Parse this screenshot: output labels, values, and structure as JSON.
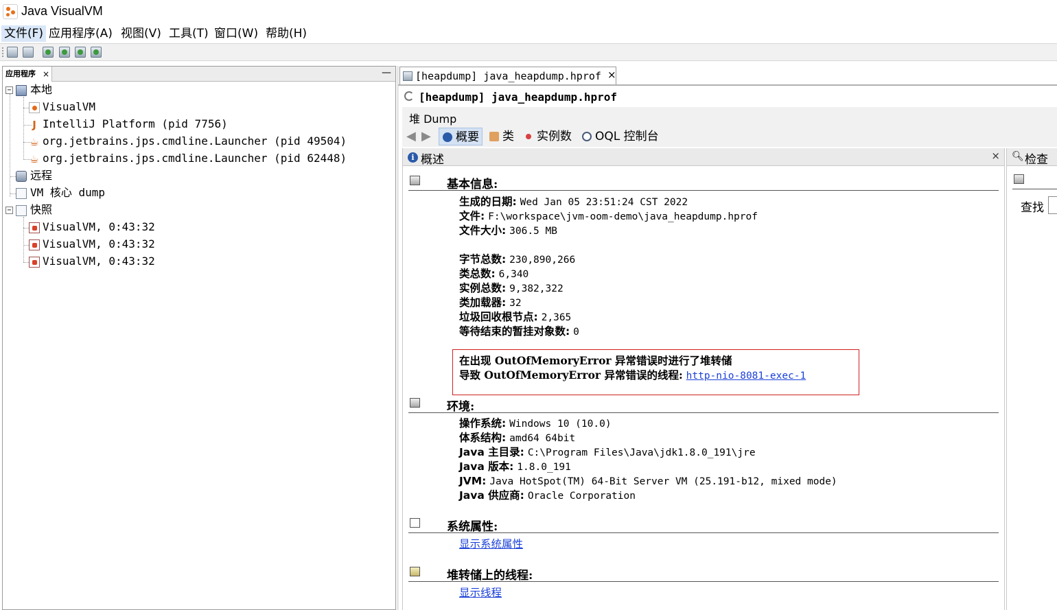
{
  "window": {
    "title": "Java VisualVM"
  },
  "menu": [
    "文件(F)",
    "应用程序(A)",
    "视图(V)",
    "工具(T)",
    "窗口(W)",
    "帮助(H)"
  ],
  "left_panel": {
    "tab_label": "应用程序",
    "tab_close": "×",
    "minimize": "—",
    "tree": {
      "local": "本地",
      "local_items": [
        "VisualVM",
        "IntelliJ Platform (pid 7756)",
        "org.jetbrains.jps.cmdline.Launcher (pid 49504)",
        "org.jetbrains.jps.cmdline.Launcher (pid 62448)"
      ],
      "remote": "远程",
      "core_dump": "VM 核心 dump",
      "snapshots": "快照",
      "snapshot_items": [
        "VisualVM, 0:43:32",
        "VisualVM, 0:43:32",
        "VisualVM, 0:43:32"
      ]
    }
  },
  "doc_tab": {
    "label": "[heapdump] java_heapdump.hprof",
    "close": "×"
  },
  "heap_title": "[heapdump] java_heapdump.hprof",
  "dump_tab": "堆 Dump",
  "nav": {
    "summary": "概要",
    "classes": "类",
    "instances": "实例数",
    "oql": "OQL 控制台"
  },
  "overview": {
    "title": "概述",
    "close": "×",
    "basic_info": {
      "heading": "基本信息:",
      "rows": [
        {
          "key": "生成的日期:",
          "value": "Wed Jan 05 23:51:24 CST 2022"
        },
        {
          "key": "文件:",
          "value": "F:\\workspace\\jvm-oom-demo\\java_heapdump.hprof"
        },
        {
          "key": "文件大小:",
          "value": "306.5 MB"
        }
      ],
      "stats": [
        {
          "key": "字节总数:",
          "value": "230,890,266"
        },
        {
          "key": "类总数:",
          "value": "6,340"
        },
        {
          "key": "实例总数:",
          "value": "9,382,322"
        },
        {
          "key": "类加载器:",
          "value": "32"
        },
        {
          "key": "垃圾回收根节点:",
          "value": "2,365"
        },
        {
          "key": "等待结束的暂挂对象数:",
          "value": "0"
        }
      ],
      "oom_line1": "在出现 OutOfMemoryError 异常错误时进行了堆转储",
      "oom_line2_label": "导致 OutOfMemoryError 异常错误的线程:",
      "oom_thread_link": "http-nio-8081-exec-1"
    },
    "environment": {
      "heading": "环境:",
      "rows": [
        {
          "key": "操作系统:",
          "value": "Windows 10 (10.0)"
        },
        {
          "key": "体系结构:",
          "value": "amd64 64bit"
        },
        {
          "key": "Java 主目录:",
          "value": "C:\\Program Files\\Java\\jdk1.8.0_191\\jre"
        },
        {
          "key": "Java 版本:",
          "value": "1.8.0_191"
        },
        {
          "key": "JVM:",
          "value": "Java HotSpot(TM) 64-Bit Server VM (25.191-b12, mixed mode)"
        },
        {
          "key": "Java 供应商:",
          "value": "Oracle Corporation"
        }
      ]
    },
    "system_properties": {
      "heading": "系统属性:",
      "link": "显示系统属性"
    },
    "threads": {
      "heading": "堆转储上的线程:",
      "link": "显示线程"
    }
  },
  "inspector": {
    "title": "检查",
    "find_label": "查找"
  },
  "colors": {
    "accent": "#1a3fd9",
    "alert_border": "#d02020",
    "selection": "#d4e2f4"
  },
  "icons": [
    "app-logo",
    "computer-icon",
    "java-icon",
    "snapshot-icon",
    "info-icon",
    "search-icon"
  ]
}
